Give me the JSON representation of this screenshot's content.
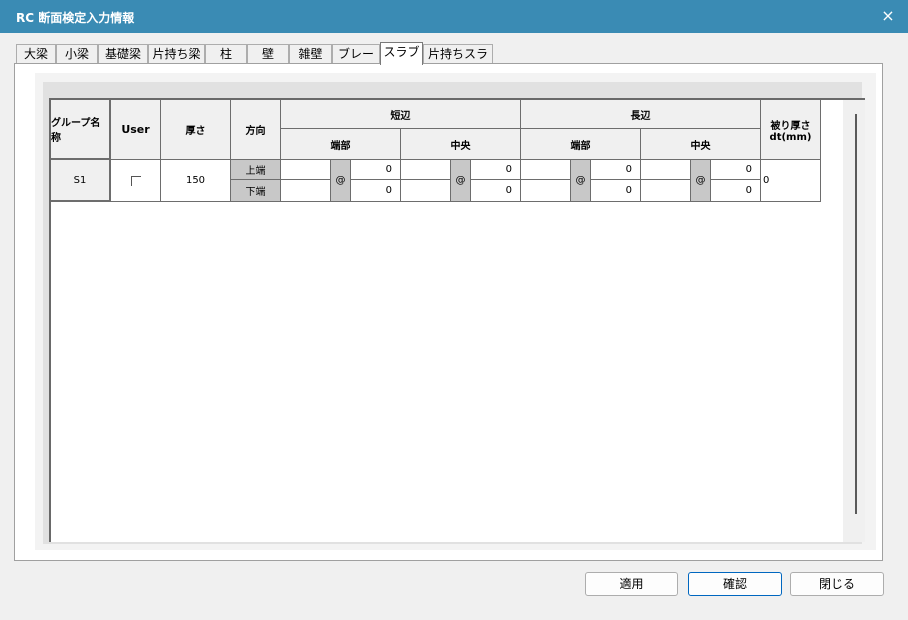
{
  "window": {
    "title": "RC 断面検定入力情報",
    "close_icon": "×"
  },
  "tabs": [
    {
      "label": "大梁"
    },
    {
      "label": "小梁"
    },
    {
      "label": "基礎梁"
    },
    {
      "label": "片持ち梁"
    },
    {
      "label": "柱"
    },
    {
      "label": "壁"
    },
    {
      "label": "雑壁"
    },
    {
      "label": "ブレース"
    },
    {
      "label": "スラブ",
      "active": true
    },
    {
      "label": "片持ちスラブ"
    }
  ],
  "table": {
    "headers": {
      "group_name": "グループ名称",
      "user": "User",
      "thickness": "厚さ",
      "direction": "方向",
      "short_side": "短辺",
      "long_side": "長辺",
      "end": "端部",
      "center": "中央",
      "cover": "被り厚さ dt(mm)"
    },
    "row": {
      "group": "S1",
      "user_checked": false,
      "thickness": "150",
      "top_label": "上端",
      "bottom_label": "下端",
      "at": "@",
      "short_end_top": "0",
      "short_end_bottom": "0",
      "short_center_top": "0",
      "short_center_bottom": "0",
      "long_end_top": "0",
      "long_end_bottom": "0",
      "long_center_top": "0",
      "long_center_bottom": "0",
      "cover": "0"
    }
  },
  "buttons": {
    "apply": "適用",
    "confirm": "確認",
    "close": "閉じる"
  }
}
